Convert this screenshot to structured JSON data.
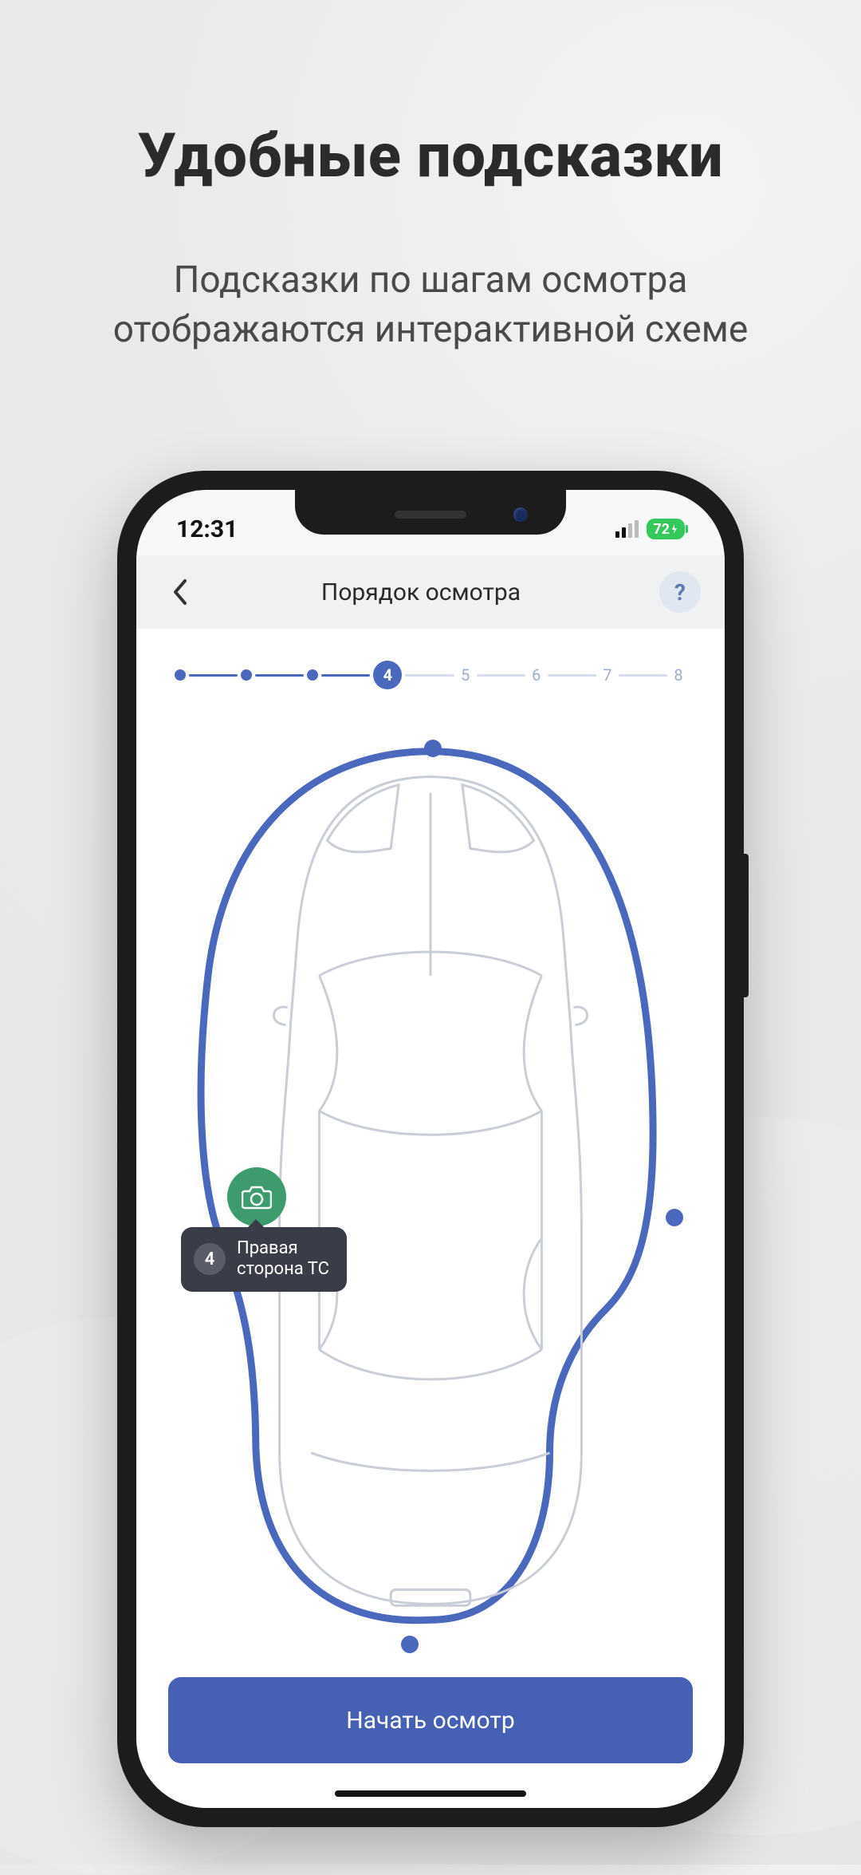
{
  "promo": {
    "title": "Удобные подсказки",
    "subtitle": "Подсказки по шагам осмотра отображаются  интерактивной схеме"
  },
  "statusbar": {
    "time": "12:31",
    "battery": "72"
  },
  "appbar": {
    "title": "Порядок осмотра",
    "help_glyph": "?"
  },
  "stepper": {
    "completed_steps": 3,
    "current_step": 4,
    "remaining_steps": [
      "5",
      "6",
      "7",
      "8"
    ]
  },
  "tooltip": {
    "step_number": "4",
    "label_line1": "Правая",
    "label_line2": "сторона ТС"
  },
  "cta": {
    "start_label": "Начать осмотр"
  }
}
